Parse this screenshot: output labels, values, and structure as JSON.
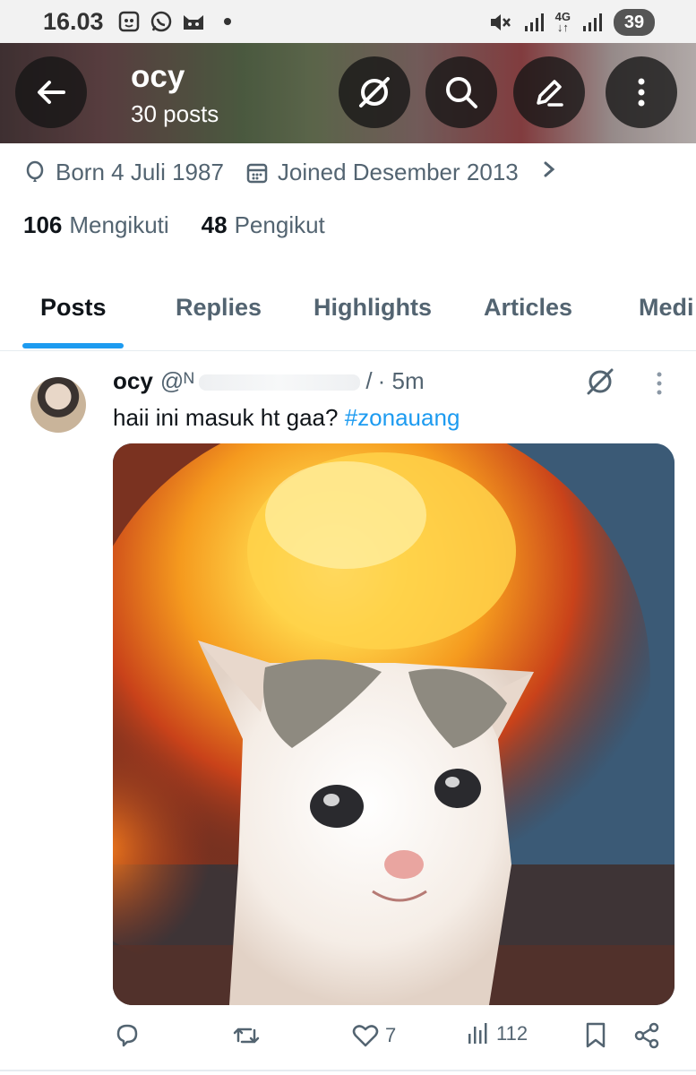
{
  "status_bar": {
    "time": "16.03",
    "network": "4G",
    "battery": "39",
    "icons_left": [
      "screenshot-icon",
      "whatsapp-icon",
      "cat-app-icon"
    ],
    "icons_right": [
      "mute-icon",
      "signal-icon",
      "signal-icon"
    ]
  },
  "header": {
    "name": "ocy",
    "posts_count": "30 posts",
    "buttons": [
      "back-arrow-icon",
      "grok-icon",
      "search-icon",
      "edit-icon",
      "more-vertical-icon"
    ]
  },
  "profile": {
    "born": "Born 4 Juli 1987",
    "joined": "Joined Desember 2013",
    "following_count": "106",
    "following_label": "Mengikuti",
    "followers_count": "48",
    "followers_label": "Pengikut"
  },
  "tabs": [
    {
      "label": "Posts",
      "active": true
    },
    {
      "label": "Replies",
      "active": false
    },
    {
      "label": "Highlights",
      "active": false
    },
    {
      "label": "Articles",
      "active": false
    },
    {
      "label": "Medi",
      "active": false
    }
  ],
  "post": {
    "name": "ocy",
    "handle_prefix": "@ᴺ",
    "handle_suffix": "/",
    "time": "· 5m",
    "text": "haii ini masuk ht gaa? ",
    "hashtag": "#zonauang",
    "media_description_icon": "crying-cat-explosion-image",
    "actions": {
      "reply": "",
      "repost": "",
      "likes": "7",
      "views": "112"
    }
  },
  "colors": {
    "accent": "#1d9bf0",
    "text_primary": "#0f1419",
    "text_secondary": "#536471"
  }
}
